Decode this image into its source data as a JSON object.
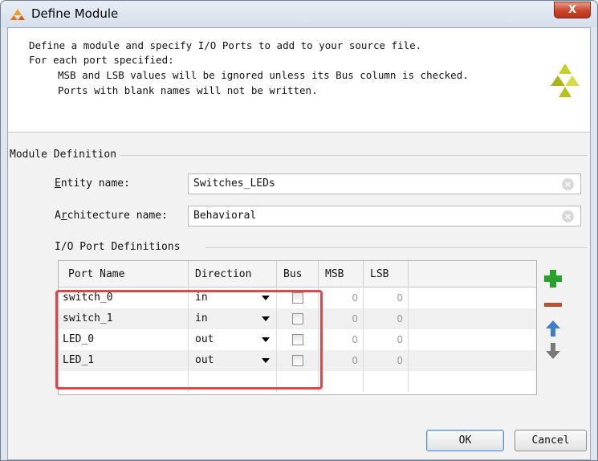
{
  "window": {
    "title": "Define Module",
    "close_label": "X"
  },
  "description": {
    "line1": "Define a module and specify I/O Ports to add to your source file.",
    "line2": "For each port specified:",
    "line3": "MSB and LSB values will be ignored unless its Bus column is checked.",
    "line4": "Ports with blank names will not be written."
  },
  "module_definition": {
    "section_label": "Module Definition",
    "entity_label_first": "E",
    "entity_label_rest": "ntity name:",
    "entity_value": "Switches_LEDs",
    "arch_label_first": "A",
    "arch_label_u": "r",
    "arch_label_rest": "chitecture name:",
    "arch_value": "Behavioral"
  },
  "io_ports": {
    "section_label": "I/O Port Definitions",
    "columns": [
      "Port Name",
      "Direction",
      "Bus",
      "MSB",
      "LSB"
    ],
    "rows": [
      {
        "name": "switch_0",
        "direction": "in",
        "bus": false,
        "msb": "0",
        "lsb": "0"
      },
      {
        "name": "switch_1",
        "direction": "in",
        "bus": false,
        "msb": "0",
        "lsb": "0"
      },
      {
        "name": "LED_0",
        "direction": "out",
        "bus": false,
        "msb": "0",
        "lsb": "0"
      },
      {
        "name": "LED_1",
        "direction": "out",
        "bus": false,
        "msb": "0",
        "lsb": "0"
      }
    ]
  },
  "buttons": {
    "ok": "OK",
    "cancel": "Cancel"
  },
  "colors": {
    "highlight": "#e0464b",
    "add": "#2aa12a",
    "remove": "#b5533a",
    "move_up": "#3f7fc8",
    "move_down": "#7a7a7a",
    "logo": "#b9c21e"
  }
}
